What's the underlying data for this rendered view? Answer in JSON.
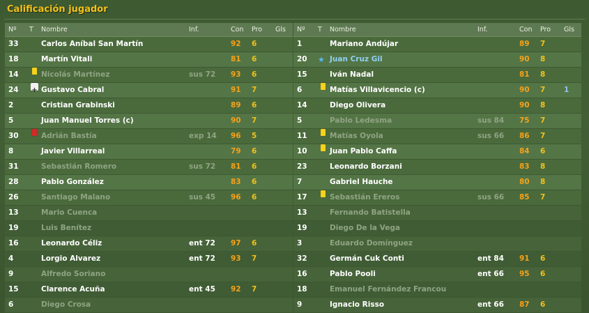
{
  "title": "Calificación jugador",
  "headers": {
    "no": "Nº",
    "t": "T",
    "name": "Nombre",
    "inf": "Inf.",
    "con": "Con",
    "pro": "Pro",
    "gls": "Gls"
  },
  "left": [
    {
      "no": "33",
      "name": "Carlos Aníbal San Martín",
      "inf": "",
      "con": "92",
      "pro": "6",
      "gls": "",
      "dim": false,
      "icon": ""
    },
    {
      "no": "18",
      "name": "Martín Vitali",
      "inf": "",
      "con": "81",
      "pro": "6",
      "gls": "",
      "dim": false,
      "icon": ""
    },
    {
      "no": "14",
      "name": "Nicolás Martínez",
      "inf": "sus 72",
      "con": "93",
      "pro": "6",
      "gls": "",
      "dim": true,
      "icon": "yellow-card"
    },
    {
      "no": "24",
      "name": "Gustavo Cabral",
      "inf": "",
      "con": "91",
      "pro": "7",
      "gls": "",
      "dim": false,
      "icon": "injury-cross"
    },
    {
      "no": "2",
      "name": "Cristian Grabinski",
      "inf": "",
      "con": "89",
      "pro": "6",
      "gls": "",
      "dim": false,
      "icon": ""
    },
    {
      "no": "5",
      "name": "Juan Manuel Torres (c)",
      "inf": "",
      "con": "90",
      "pro": "7",
      "gls": "",
      "dim": false,
      "icon": ""
    },
    {
      "no": "30",
      "name": "Adrián Bastía",
      "inf": "exp 14",
      "con": "96",
      "pro": "5",
      "gls": "",
      "dim": true,
      "icon": "red-card"
    },
    {
      "no": "8",
      "name": "Javier Villarreal",
      "inf": "",
      "con": "79",
      "pro": "6",
      "gls": "",
      "dim": false,
      "icon": ""
    },
    {
      "no": "31",
      "name": "Sebastián Romero",
      "inf": "sus 72",
      "con": "81",
      "pro": "6",
      "gls": "",
      "dim": true,
      "icon": ""
    },
    {
      "no": "28",
      "name": "Pablo González",
      "inf": "",
      "con": "83",
      "pro": "6",
      "gls": "",
      "dim": false,
      "icon": ""
    },
    {
      "no": "26",
      "name": "Santiago Malano",
      "inf": "sus 45",
      "con": "96",
      "pro": "6",
      "gls": "",
      "dim": true,
      "icon": ""
    },
    {
      "no": "13",
      "name": "Mario Cuenca",
      "inf": "",
      "con": "",
      "pro": "",
      "gls": "",
      "dim": true,
      "bench": true,
      "icon": ""
    },
    {
      "no": "19",
      "name": "Luis Benítez",
      "inf": "",
      "con": "",
      "pro": "",
      "gls": "",
      "dim": true,
      "bench": true,
      "icon": ""
    },
    {
      "no": "16",
      "name": "Leonardo Céliz",
      "inf": "ent 72",
      "con": "97",
      "pro": "6",
      "gls": "",
      "dim": false,
      "bench": true,
      "icon": ""
    },
    {
      "no": "4",
      "name": "Lorgio Alvarez",
      "inf": "ent 72",
      "con": "93",
      "pro": "7",
      "gls": "",
      "dim": false,
      "bench": true,
      "icon": ""
    },
    {
      "no": "9",
      "name": "Alfredo Soriano",
      "inf": "",
      "con": "",
      "pro": "",
      "gls": "",
      "dim": true,
      "bench": true,
      "icon": ""
    },
    {
      "no": "15",
      "name": "Clarence Acuña",
      "inf": "ent 45",
      "con": "92",
      "pro": "7",
      "gls": "",
      "dim": false,
      "bench": true,
      "icon": ""
    },
    {
      "no": "6",
      "name": "Diego Crosa",
      "inf": "",
      "con": "",
      "pro": "",
      "gls": "",
      "dim": true,
      "bench": true,
      "icon": ""
    }
  ],
  "right": [
    {
      "no": "1",
      "name": "Mariano Andújar",
      "inf": "",
      "con": "89",
      "pro": "7",
      "gls": "",
      "dim": false,
      "icon": ""
    },
    {
      "no": "20",
      "name": "Juan Cruz Gil",
      "inf": "",
      "con": "90",
      "pro": "8",
      "gls": "",
      "dim": false,
      "icon": "star",
      "special": true
    },
    {
      "no": "15",
      "name": "Iván Nadal",
      "inf": "",
      "con": "81",
      "pro": "8",
      "gls": "",
      "dim": false,
      "icon": ""
    },
    {
      "no": "6",
      "name": "Matías Villavicencio (c)",
      "inf": "",
      "con": "90",
      "pro": "7",
      "gls": "1",
      "dim": false,
      "icon": "yellow-card"
    },
    {
      "no": "14",
      "name": "Diego Olivera",
      "inf": "",
      "con": "90",
      "pro": "8",
      "gls": "",
      "dim": false,
      "icon": ""
    },
    {
      "no": "5",
      "name": "Pablo Ledesma",
      "inf": "sus 84",
      "con": "75",
      "pro": "7",
      "gls": "",
      "dim": true,
      "icon": ""
    },
    {
      "no": "11",
      "name": "Matías Oyola",
      "inf": "sus 66",
      "con": "86",
      "pro": "7",
      "gls": "",
      "dim": true,
      "icon": "yellow-card"
    },
    {
      "no": "10",
      "name": "Juan Pablo Caffa",
      "inf": "",
      "con": "84",
      "pro": "6",
      "gls": "",
      "dim": false,
      "icon": "yellow-card"
    },
    {
      "no": "23",
      "name": "Leonardo Borzani",
      "inf": "",
      "con": "83",
      "pro": "8",
      "gls": "",
      "dim": false,
      "icon": ""
    },
    {
      "no": "7",
      "name": "Gabriel Hauche",
      "inf": "",
      "con": "80",
      "pro": "8",
      "gls": "",
      "dim": false,
      "icon": ""
    },
    {
      "no": "17",
      "name": "Sebastián Ereros",
      "inf": "sus 66",
      "con": "85",
      "pro": "7",
      "gls": "",
      "dim": true,
      "icon": "yellow-card"
    },
    {
      "no": "13",
      "name": "Fernando Batistella",
      "inf": "",
      "con": "",
      "pro": "",
      "gls": "",
      "dim": true,
      "bench": true,
      "icon": ""
    },
    {
      "no": "19",
      "name": "Diego De la Vega",
      "inf": "",
      "con": "",
      "pro": "",
      "gls": "",
      "dim": true,
      "bench": true,
      "icon": ""
    },
    {
      "no": "3",
      "name": "Eduardo Domínguez",
      "inf": "",
      "con": "",
      "pro": "",
      "gls": "",
      "dim": true,
      "bench": true,
      "icon": ""
    },
    {
      "no": "32",
      "name": "Germán Cuk Conti",
      "inf": "ent 84",
      "con": "91",
      "pro": "6",
      "gls": "",
      "dim": false,
      "bench": true,
      "icon": ""
    },
    {
      "no": "16",
      "name": "Pablo Pooli",
      "inf": "ent 66",
      "con": "95",
      "pro": "6",
      "gls": "",
      "dim": false,
      "bench": true,
      "icon": ""
    },
    {
      "no": "18",
      "name": "Emanuel Fernández Francou",
      "inf": "",
      "con": "",
      "pro": "",
      "gls": "",
      "dim": true,
      "bench": true,
      "icon": ""
    },
    {
      "no": "9",
      "name": "Ignacio Risso",
      "inf": "ent 66",
      "con": "87",
      "pro": "6",
      "gls": "",
      "dim": false,
      "bench": true,
      "icon": ""
    }
  ]
}
